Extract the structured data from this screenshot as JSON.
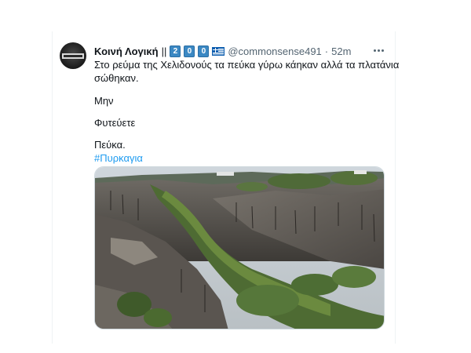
{
  "tweet": {
    "author_name": "Κοινή Λογική",
    "name_separator": "||",
    "badges": [
      "2",
      "0",
      "0"
    ],
    "flag_icon": "greek-flag-icon",
    "handle": "@commonsense491",
    "dot": "·",
    "time": "52m",
    "more_icon": "more-options-icon",
    "text_lines": [
      "Στο ρεύμα της Χελιδονούς τα πεύκα γύρω κάηκαν αλλά τα πλατάνια",
      "σώθηκαν.",
      "Μην",
      "Φυτεύετε",
      "Πεύκα."
    ],
    "hashtag": "#Πυρκαγια",
    "media": {
      "kind": "photo",
      "subject": "burned-hillside-ravine-photo"
    }
  },
  "colors": {
    "accent": "#1d9bf0",
    "muted": "#536471",
    "text": "#0f1419",
    "badge": "#3b88c3"
  }
}
